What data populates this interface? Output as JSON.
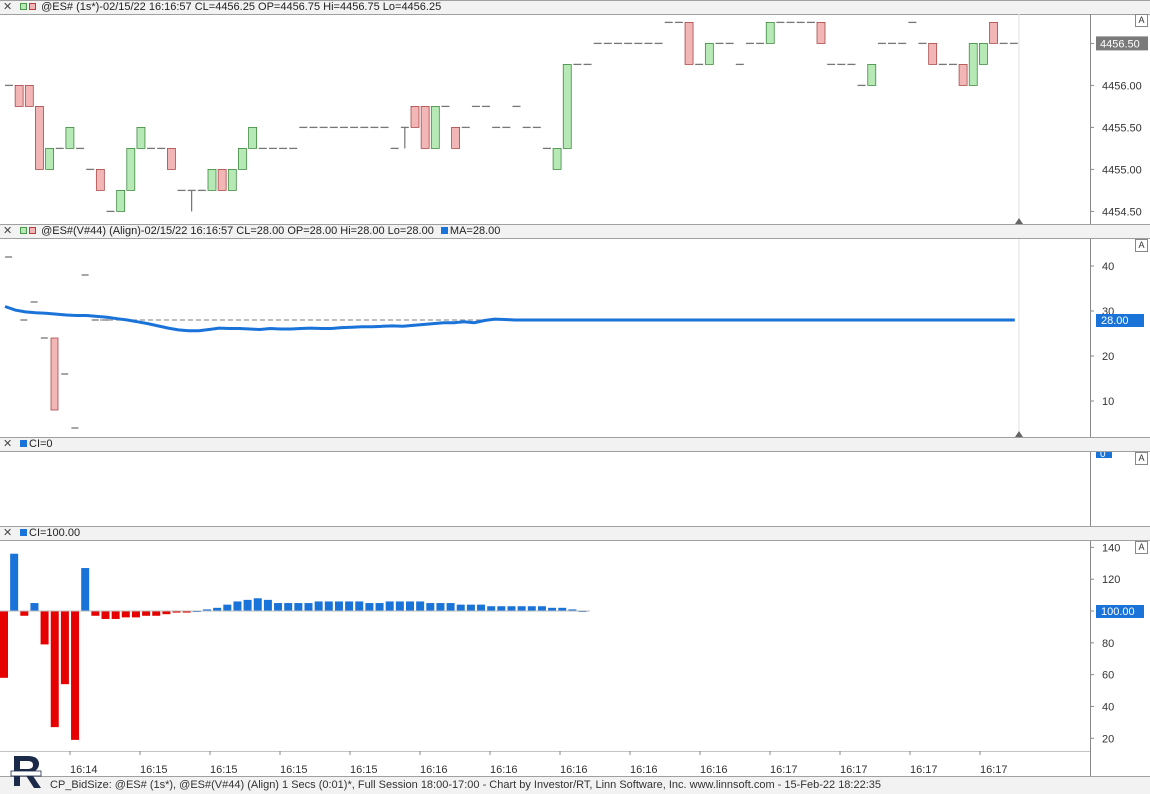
{
  "panes": [
    {
      "id": "price",
      "header_text": "@ES# (1s*)-02/15/22 16:16:57 CL=4456.25 OP=4456.75 Hi=4456.75 Lo=4456.25",
      "a_label": "A"
    },
    {
      "id": "volume",
      "header_text": "@ES#(V#44) (Align)-02/15/22 16:16:57 CL=28.00 OP=28.00 Hi=28.00 Lo=28.00",
      "ma_text": "MA=28.00",
      "a_label": "A"
    },
    {
      "id": "ci0",
      "header_text": "CI=0",
      "a_label": "A"
    },
    {
      "id": "ci100",
      "header_text": "CI=100.00",
      "a_label": "A"
    }
  ],
  "price_axis": {
    "ticks": [
      "4456.50",
      "4456.00",
      "4455.50",
      "4455.00",
      "4454.50"
    ],
    "current": "4456.50"
  },
  "volume_axis": {
    "ticks": [
      "40",
      "30",
      "20",
      "10"
    ],
    "current": "28.00"
  },
  "ci0_axis": {
    "current": "0"
  },
  "ci100_axis": {
    "ticks": [
      "140",
      "120",
      "100",
      "80",
      "60",
      "40",
      "20"
    ],
    "current": "100.00"
  },
  "time_axis": {
    "labels": [
      "16:14",
      "16:15",
      "16:15",
      "16:15",
      "16:15",
      "16:16",
      "16:16",
      "16:16",
      "16:16",
      "16:16",
      "16:17",
      "16:17",
      "16:17",
      "16:17"
    ]
  },
  "status_text": "CP_BidSize: @ES# (1s*), @ES#(V#44) (Align) 1 Secs (0:01)*, Full Session 18:00-17:00 - Chart by Investor/RT, Linn Software, Inc. www.linnsoft.com - 15-Feb-22 18:22:35",
  "colors": {
    "up": "#b6e9b6",
    "down": "#f3b6b6",
    "line": "#1a73d9",
    "pos_bar": "#1a73d9",
    "neg_bar": "#e60000",
    "grid": "#c0c0c0"
  },
  "chart_data": [
    {
      "type": "candlestick",
      "title": "@ES# (1s*)",
      "ylim": [
        4454.35,
        4456.85
      ],
      "candles": [
        [
          4456.0,
          4456.0,
          4456.0,
          4456.0
        ],
        [
          4456.0,
          4455.75,
          4456.0,
          4455.75
        ],
        [
          4456.0,
          4455.75,
          4456.0,
          4455.75
        ],
        [
          4455.75,
          4455.0,
          4455.75,
          4455.0
        ],
        [
          4455.0,
          4455.25,
          4455.25,
          4455.0
        ],
        [
          4455.25,
          4455.25,
          4455.25,
          4455.25
        ],
        [
          4455.25,
          4455.5,
          4455.5,
          4455.25
        ],
        [
          4455.25,
          4455.25,
          4455.25,
          4455.25
        ],
        [
          4455.0,
          4455.0,
          4455.0,
          4455.0
        ],
        [
          4455.0,
          4454.75,
          4455.0,
          4454.75
        ],
        [
          4454.5,
          4454.5,
          4454.5,
          4454.5
        ],
        [
          4454.5,
          4454.75,
          4454.75,
          4454.5
        ],
        [
          4454.75,
          4455.25,
          4455.25,
          4454.75
        ],
        [
          4455.25,
          4455.5,
          4455.5,
          4455.25
        ],
        [
          4455.25,
          4455.25,
          4455.25,
          4455.25
        ],
        [
          4455.25,
          4455.25,
          4455.25,
          4455.25
        ],
        [
          4455.25,
          4455.0,
          4455.25,
          4455.0
        ],
        [
          4454.75,
          4454.75,
          4454.75,
          4454.75
        ],
        [
          4454.75,
          4454.75,
          4454.75,
          4454.5
        ],
        [
          4454.75,
          4454.75,
          4454.75,
          4454.75
        ],
        [
          4454.75,
          4455.0,
          4455.0,
          4454.75
        ],
        [
          4455.0,
          4454.75,
          4455.0,
          4454.75
        ],
        [
          4454.75,
          4455.0,
          4455.0,
          4454.75
        ],
        [
          4455.0,
          4455.25,
          4455.25,
          4455.0
        ],
        [
          4455.25,
          4455.5,
          4455.5,
          4455.25
        ],
        [
          4455.25,
          4455.25,
          4455.25,
          4455.25
        ],
        [
          4455.25,
          4455.25,
          4455.25,
          4455.25
        ],
        [
          4455.25,
          4455.25,
          4455.25,
          4455.25
        ],
        [
          4455.25,
          4455.25,
          4455.25,
          4455.25
        ],
        [
          4455.5,
          4455.5,
          4455.5,
          4455.5
        ],
        [
          4455.5,
          4455.5,
          4455.5,
          4455.5
        ],
        [
          4455.5,
          4455.5,
          4455.5,
          4455.5
        ],
        [
          4455.5,
          4455.5,
          4455.5,
          4455.5
        ],
        [
          4455.5,
          4455.5,
          4455.5,
          4455.5
        ],
        [
          4455.5,
          4455.5,
          4455.5,
          4455.5
        ],
        [
          4455.5,
          4455.5,
          4455.5,
          4455.5
        ],
        [
          4455.5,
          4455.5,
          4455.5,
          4455.5
        ],
        [
          4455.5,
          4455.5,
          4455.5,
          4455.5
        ],
        [
          4455.25,
          4455.25,
          4455.25,
          4455.25
        ],
        [
          4455.5,
          4455.5,
          4455.5,
          4455.25
        ],
        [
          4455.75,
          4455.5,
          4455.75,
          4455.5
        ],
        [
          4455.75,
          4455.25,
          4455.75,
          4455.25
        ],
        [
          4455.25,
          4455.75,
          4455.75,
          4455.25
        ],
        [
          4455.75,
          4455.75,
          4455.75,
          4455.75
        ],
        [
          4455.5,
          4455.25,
          4455.5,
          4455.25
        ],
        [
          4455.5,
          4455.5,
          4455.5,
          4455.5
        ],
        [
          4455.75,
          4455.75,
          4455.75,
          4455.75
        ],
        [
          4455.75,
          4455.75,
          4455.75,
          4455.75
        ],
        [
          4455.5,
          4455.5,
          4455.5,
          4455.5
        ],
        [
          4455.5,
          4455.5,
          4455.5,
          4455.5
        ],
        [
          4455.75,
          4455.75,
          4455.75,
          4455.75
        ],
        [
          4455.5,
          4455.5,
          4455.5,
          4455.5
        ],
        [
          4455.5,
          4455.5,
          4455.5,
          4455.5
        ],
        [
          4455.25,
          4455.25,
          4455.25,
          4455.25
        ],
        [
          4455.0,
          4455.25,
          4455.25,
          4455.0
        ],
        [
          4455.25,
          4456.25,
          4456.25,
          4455.25
        ],
        [
          4456.25,
          4456.25,
          4456.25,
          4456.25
        ],
        [
          4456.25,
          4456.25,
          4456.25,
          4456.25
        ],
        [
          4456.5,
          4456.5,
          4456.5,
          4456.5
        ],
        [
          4456.5,
          4456.5,
          4456.5,
          4456.5
        ],
        [
          4456.5,
          4456.5,
          4456.5,
          4456.5
        ],
        [
          4456.5,
          4456.5,
          4456.5,
          4456.5
        ],
        [
          4456.5,
          4456.5,
          4456.5,
          4456.5
        ],
        [
          4456.5,
          4456.5,
          4456.5,
          4456.5
        ],
        [
          4456.5,
          4456.5,
          4456.5,
          4456.5
        ],
        [
          4456.75,
          4456.75,
          4456.75,
          4456.75
        ],
        [
          4456.75,
          4456.75,
          4456.75,
          4456.75
        ],
        [
          4456.75,
          4456.25,
          4456.75,
          4456.25
        ],
        [
          4456.25,
          4456.25,
          4456.25,
          4456.25
        ],
        [
          4456.25,
          4456.5,
          4456.5,
          4456.25
        ],
        [
          4456.5,
          4456.5,
          4456.5,
          4456.5
        ],
        [
          4456.5,
          4456.5,
          4456.5,
          4456.5
        ],
        [
          4456.25,
          4456.25,
          4456.25,
          4456.25
        ],
        [
          4456.5,
          4456.5,
          4456.5,
          4456.5
        ],
        [
          4456.5,
          4456.5,
          4456.5,
          4456.5
        ],
        [
          4456.5,
          4456.75,
          4456.75,
          4456.5
        ],
        [
          4456.75,
          4456.75,
          4456.75,
          4456.75
        ],
        [
          4456.75,
          4456.75,
          4456.75,
          4456.75
        ],
        [
          4456.75,
          4456.75,
          4456.75,
          4456.75
        ],
        [
          4456.75,
          4456.75,
          4456.75,
          4456.75
        ],
        [
          4456.75,
          4456.5,
          4456.75,
          4456.5
        ],
        [
          4456.25,
          4456.25,
          4456.25,
          4456.25
        ],
        [
          4456.25,
          4456.25,
          4456.25,
          4456.25
        ],
        [
          4456.25,
          4456.25,
          4456.25,
          4456.25
        ],
        [
          4456.0,
          4456.0,
          4456.0,
          4456.0
        ],
        [
          4456.0,
          4456.25,
          4456.25,
          4456.0
        ],
        [
          4456.5,
          4456.5,
          4456.5,
          4456.5
        ],
        [
          4456.5,
          4456.5,
          4456.5,
          4456.5
        ],
        [
          4456.5,
          4456.5,
          4456.5,
          4456.5
        ],
        [
          4456.75,
          4456.75,
          4456.75,
          4456.75
        ],
        [
          4456.5,
          4456.5,
          4456.5,
          4456.5
        ],
        [
          4456.5,
          4456.25,
          4456.5,
          4456.25
        ],
        [
          4456.25,
          4456.25,
          4456.25,
          4456.25
        ],
        [
          4456.25,
          4456.25,
          4456.25,
          4456.25
        ],
        [
          4456.25,
          4456.0,
          4456.25,
          4456.0
        ],
        [
          4456.0,
          4456.5,
          4456.5,
          4456.0
        ],
        [
          4456.25,
          4456.5,
          4456.5,
          4456.25
        ],
        [
          4456.75,
          4456.5,
          4456.75,
          4456.5
        ],
        [
          4456.5,
          4456.5,
          4456.5,
          4456.5
        ],
        [
          4456.5,
          4456.5,
          4456.5,
          4456.5
        ]
      ]
    },
    {
      "type": "bar+line",
      "title": "@ES#(V#44) (Align)",
      "ylim": [
        2,
        46
      ],
      "volume_bars": [
        {
          "i": 1,
          "open": 42,
          "close": 42
        },
        {
          "i": 4,
          "open": 28,
          "close": 28
        },
        {
          "i": 6,
          "open": 32,
          "close": 32
        },
        {
          "i": 8,
          "open": 24,
          "close": 24
        },
        {
          "i": 10,
          "open": 24,
          "close": 8
        },
        {
          "i": 12,
          "open": 16,
          "close": 16
        },
        {
          "i": 14,
          "open": 4,
          "close": 4
        },
        {
          "i": 16,
          "open": 38,
          "close": 38
        },
        {
          "i": 18,
          "open": 28,
          "close": 28
        },
        {
          "i": 20,
          "open": 28,
          "close": 28
        }
      ],
      "flat_value": 28,
      "ma_name": "MA",
      "ma_values": [
        31,
        30.2,
        29.8,
        29.6,
        29.5,
        29.3,
        29.1,
        29.0,
        29.0,
        28.8,
        28.6,
        28.3,
        28.0,
        27.6,
        27.2,
        26.7,
        26.2,
        25.8,
        25.6,
        25.6,
        25.9,
        26.2,
        26.1,
        26.1,
        26.0,
        25.9,
        26.1,
        26.0,
        26.0,
        26.1,
        26.2,
        26.1,
        26.1,
        26.3,
        26.4,
        26.5,
        26.5,
        26.6,
        26.7,
        26.6,
        26.8,
        27.0,
        27.2,
        27.4,
        27.4,
        27.6,
        27.4,
        27.9,
        28.2,
        28.1,
        28.0,
        28.0,
        28.0,
        28.0,
        28.0,
        28.0,
        28.0,
        28.0,
        28.0,
        28.0,
        28.0,
        28.0,
        28.0,
        28.0,
        28.0,
        28.0,
        28.0,
        28.0,
        28.0,
        28.0,
        28.0,
        28.0,
        28.0,
        28.0,
        28.0,
        28.0,
        28.0,
        28.0,
        28.0,
        28.0,
        28.0,
        28.0,
        28.0,
        28.0,
        28.0,
        28.0,
        28.0,
        28.0,
        28.0,
        28.0,
        28.0,
        28.0,
        28.0,
        28.0,
        28.0,
        28.0,
        28.0,
        28.0,
        28.0,
        28.0
      ]
    },
    {
      "type": "bar",
      "title": "CI=100.00",
      "ylim": [
        12,
        144
      ],
      "baseline": 100,
      "values": [
        58,
        136,
        97,
        105,
        79,
        27,
        54,
        19,
        127,
        97,
        95,
        95,
        96,
        96,
        97,
        97,
        98,
        99,
        99,
        100,
        101,
        102,
        104,
        106,
        107,
        108,
        107,
        105,
        105,
        105,
        105,
        106,
        106,
        106,
        106,
        106,
        105,
        105,
        106,
        106,
        106,
        106,
        105,
        105,
        105,
        104,
        104,
        104,
        103,
        103,
        103,
        103,
        103,
        103,
        102,
        102,
        101,
        100
      ]
    }
  ]
}
